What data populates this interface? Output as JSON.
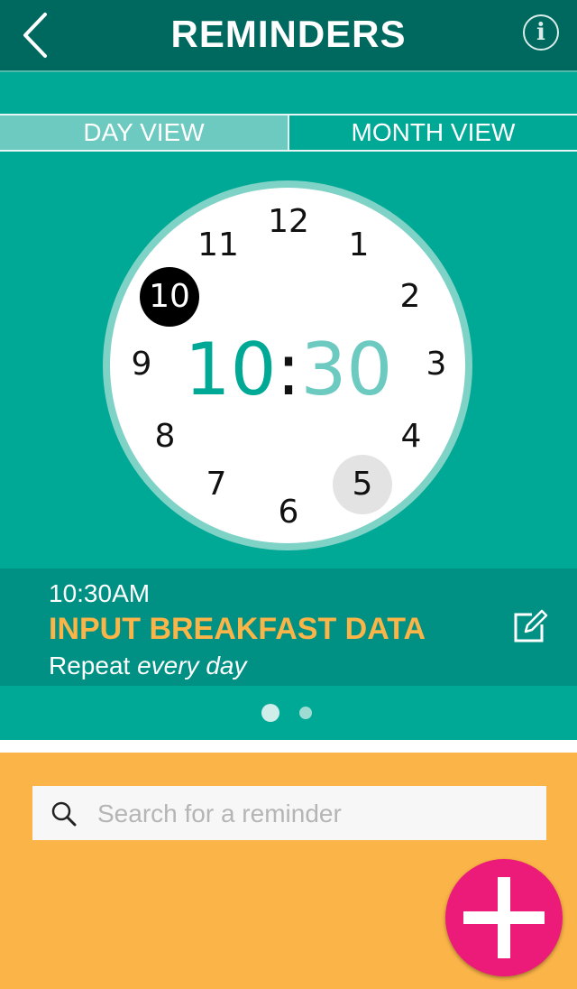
{
  "header": {
    "title": "REMINDERS",
    "back_icon": "chevron-left-icon",
    "info_icon": "info-icon",
    "info_glyph": "i"
  },
  "tabs": [
    {
      "label": "DAY VIEW",
      "active": true
    },
    {
      "label": "MONTH VIEW",
      "active": false
    }
  ],
  "clock": {
    "numbers": [
      "12",
      "1",
      "2",
      "3",
      "4",
      "5",
      "6",
      "7",
      "8",
      "9",
      "10",
      "11"
    ],
    "selected_hour": "10",
    "selected_minute_marker": "5",
    "time_hour": "10",
    "time_separator": ":",
    "time_minute": "30"
  },
  "reminder": {
    "time": "10:30AM",
    "title": "INPUT BREAKFAST DATA",
    "repeat_prefix": "Repeat",
    "repeat_value": "every day",
    "edit_icon": "edit-icon"
  },
  "pager": {
    "count": 2,
    "active_index": 0
  },
  "search": {
    "placeholder": "Search for a reminder",
    "value": "",
    "icon": "search-icon"
  },
  "fab": {
    "icon": "plus-icon"
  },
  "colors": {
    "header": "#00695f",
    "teal": "#00a896",
    "teal_light": "#6ccac0",
    "reminder_bg": "#009184",
    "orange": "#fbb447",
    "pink": "#ec1b7a"
  }
}
